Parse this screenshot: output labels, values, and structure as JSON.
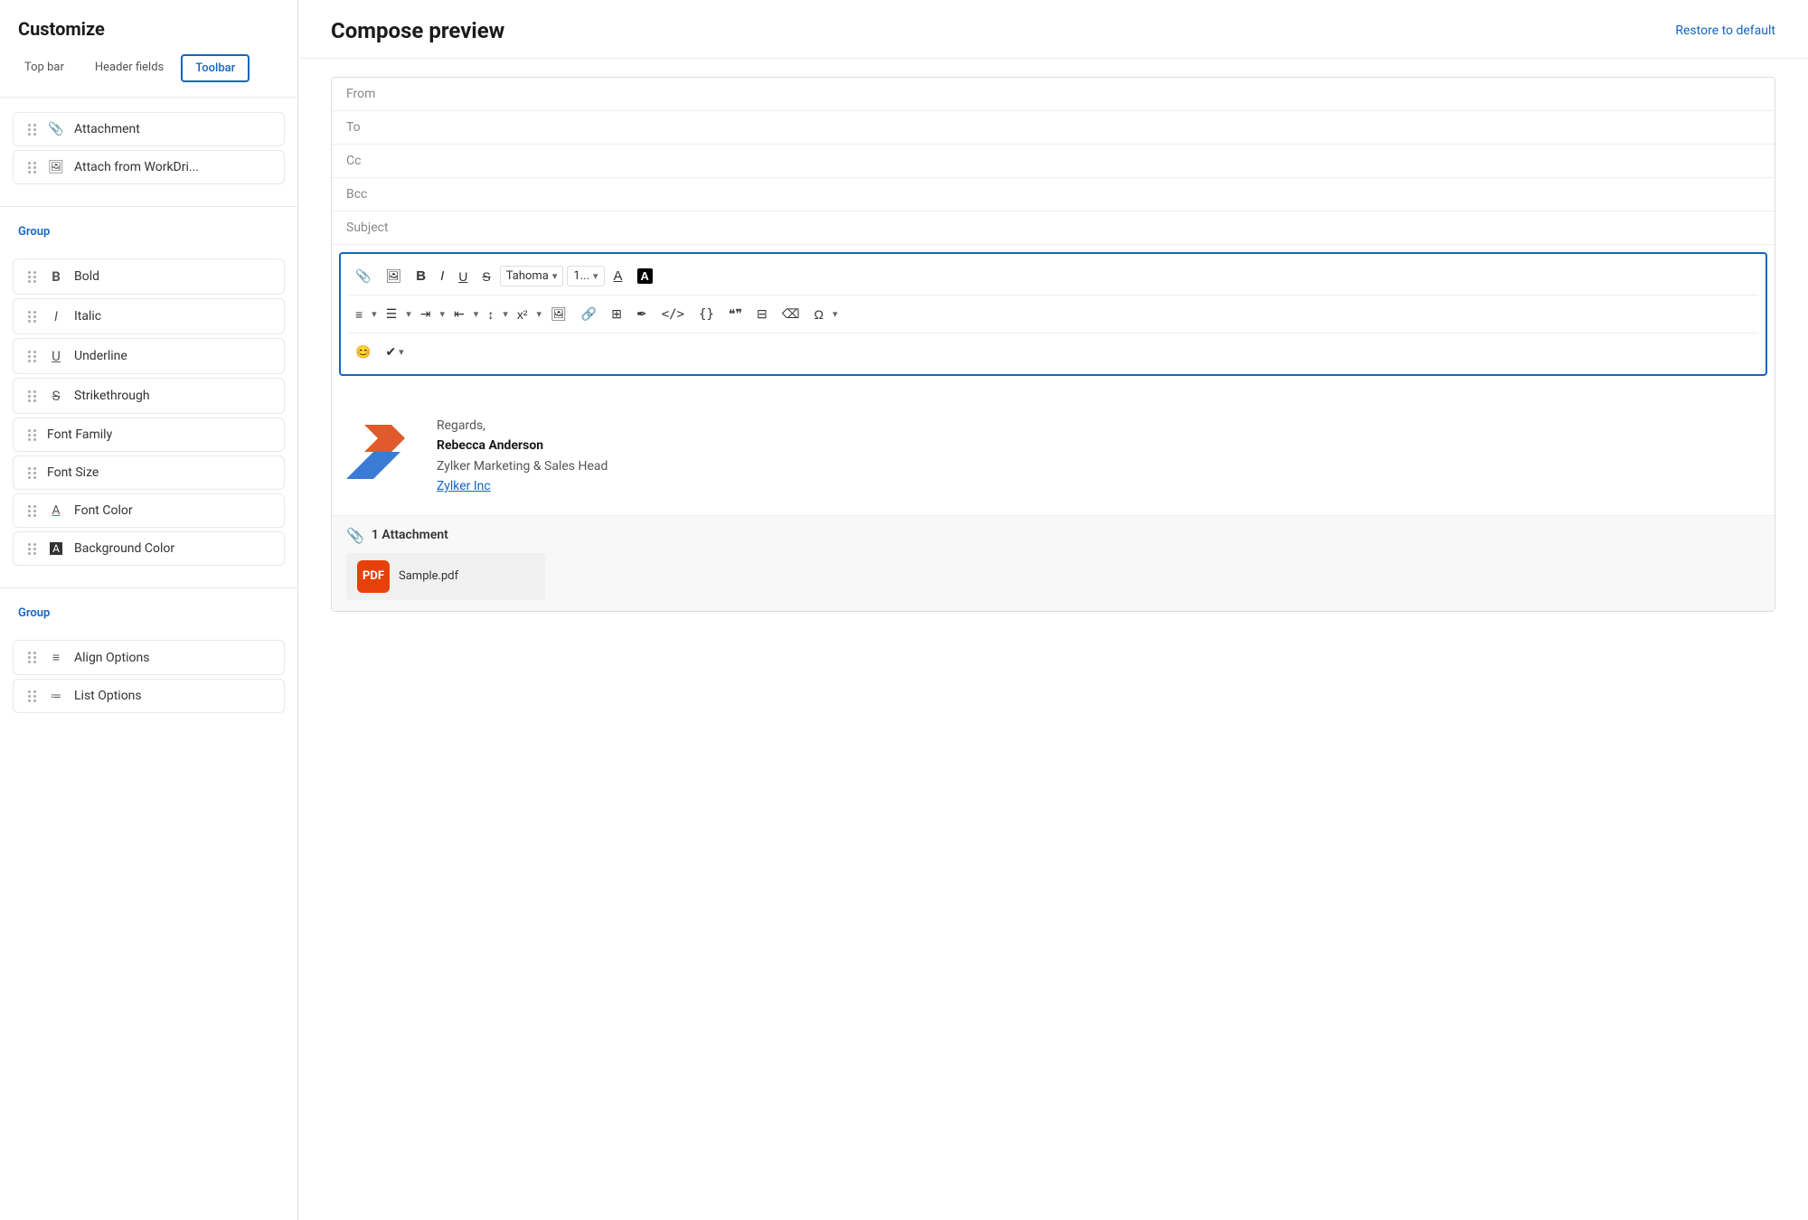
{
  "sidebar": {
    "title": "Customize",
    "tabs": [
      {
        "id": "top-bar",
        "label": "Top bar",
        "active": false
      },
      {
        "id": "header-fields",
        "label": "Header fields",
        "active": false
      },
      {
        "id": "toolbar",
        "label": "Toolbar",
        "active": true
      }
    ],
    "items_top": [
      {
        "id": "attachment",
        "label": "Attachment",
        "icon": "📎"
      },
      {
        "id": "attach-workdri",
        "label": "Attach from WorkDri...",
        "icon": "🖼"
      }
    ],
    "group1_label": "Group",
    "items_group1": [
      {
        "id": "bold",
        "label": "Bold",
        "icon": "B"
      },
      {
        "id": "italic",
        "label": "Italic",
        "icon": "I"
      },
      {
        "id": "underline",
        "label": "Underline",
        "icon": "U"
      },
      {
        "id": "strikethrough",
        "label": "Strikethrough",
        "icon": "S"
      },
      {
        "id": "font-family",
        "label": "Font Family",
        "icon": ""
      },
      {
        "id": "font-size",
        "label": "Font Size",
        "icon": ""
      },
      {
        "id": "font-color",
        "label": "Font Color",
        "icon": "A"
      },
      {
        "id": "background-color",
        "label": "Background Color",
        "icon": "A"
      }
    ],
    "group2_label": "Group",
    "items_group2": [
      {
        "id": "align-options",
        "label": "Align Options",
        "icon": "≡"
      },
      {
        "id": "list-options",
        "label": "List Options",
        "icon": "≡"
      }
    ]
  },
  "main": {
    "title": "Compose preview",
    "restore_label": "Restore to default",
    "email_fields": [
      {
        "id": "from",
        "label": "From"
      },
      {
        "id": "to",
        "label": "To"
      },
      {
        "id": "cc",
        "label": "Cc"
      },
      {
        "id": "bcc",
        "label": "Bcc"
      },
      {
        "id": "subject",
        "label": "Subject"
      }
    ],
    "toolbar": {
      "font_family": "Tahoma",
      "font_size": "1...",
      "rows": [
        [
          "attachment",
          "image",
          "bold",
          "italic",
          "underline",
          "strikethrough",
          "font-family-select",
          "font-size-select",
          "font-color",
          "highlight"
        ],
        [
          "align",
          "bullets",
          "indent",
          "outdent",
          "line-height",
          "superscript",
          "image-insert",
          "link",
          "table",
          "signature",
          "code-inline",
          "code-block",
          "blockquote",
          "grid",
          "remove-format",
          "special-char"
        ],
        [
          "emoji",
          "more"
        ]
      ]
    },
    "signature": {
      "greeting": "Regards,",
      "name": "Rebecca Anderson",
      "title": "Zylker Marketing & Sales Head",
      "company_link": "Zylker Inc"
    },
    "attachment_section": {
      "count_label": "1 Attachment",
      "file_name": "Sample.pdf"
    }
  }
}
